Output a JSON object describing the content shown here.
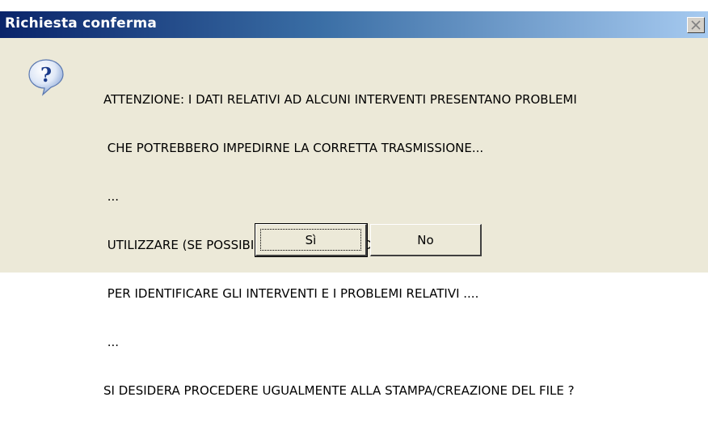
{
  "window": {
    "title": "Richiesta conferma"
  },
  "dialog": {
    "icon": "question-icon",
    "message_lines": [
      "ATTENZIONE: I DATI RELATIVI AD ALCUNI INTERVENTI PRESENTANO PROBLEMI",
      " CHE POTREBBERO IMPEDIRNE LA CORRETTA TRASMISSIONE...",
      " ...",
      " UTILIZZARE (SE POSSIBILE) LA FUNZIONE DI VERIFICA ....",
      " PER IDENTIFICARE GLI INTERVENTI E I PROBLEMI RELATIVI ....",
      " ...",
      "SI DESIDERA PROCEDERE UGUALMENTE ALLA STAMPA/CREAZIONE DEL FILE ?"
    ],
    "buttons": {
      "yes_label": "Sì",
      "no_label": "No"
    }
  },
  "colors": {
    "titlebar_start": "#0a246a",
    "titlebar_end": "#a6caf0",
    "dialog_bg": "#ece9d8"
  }
}
